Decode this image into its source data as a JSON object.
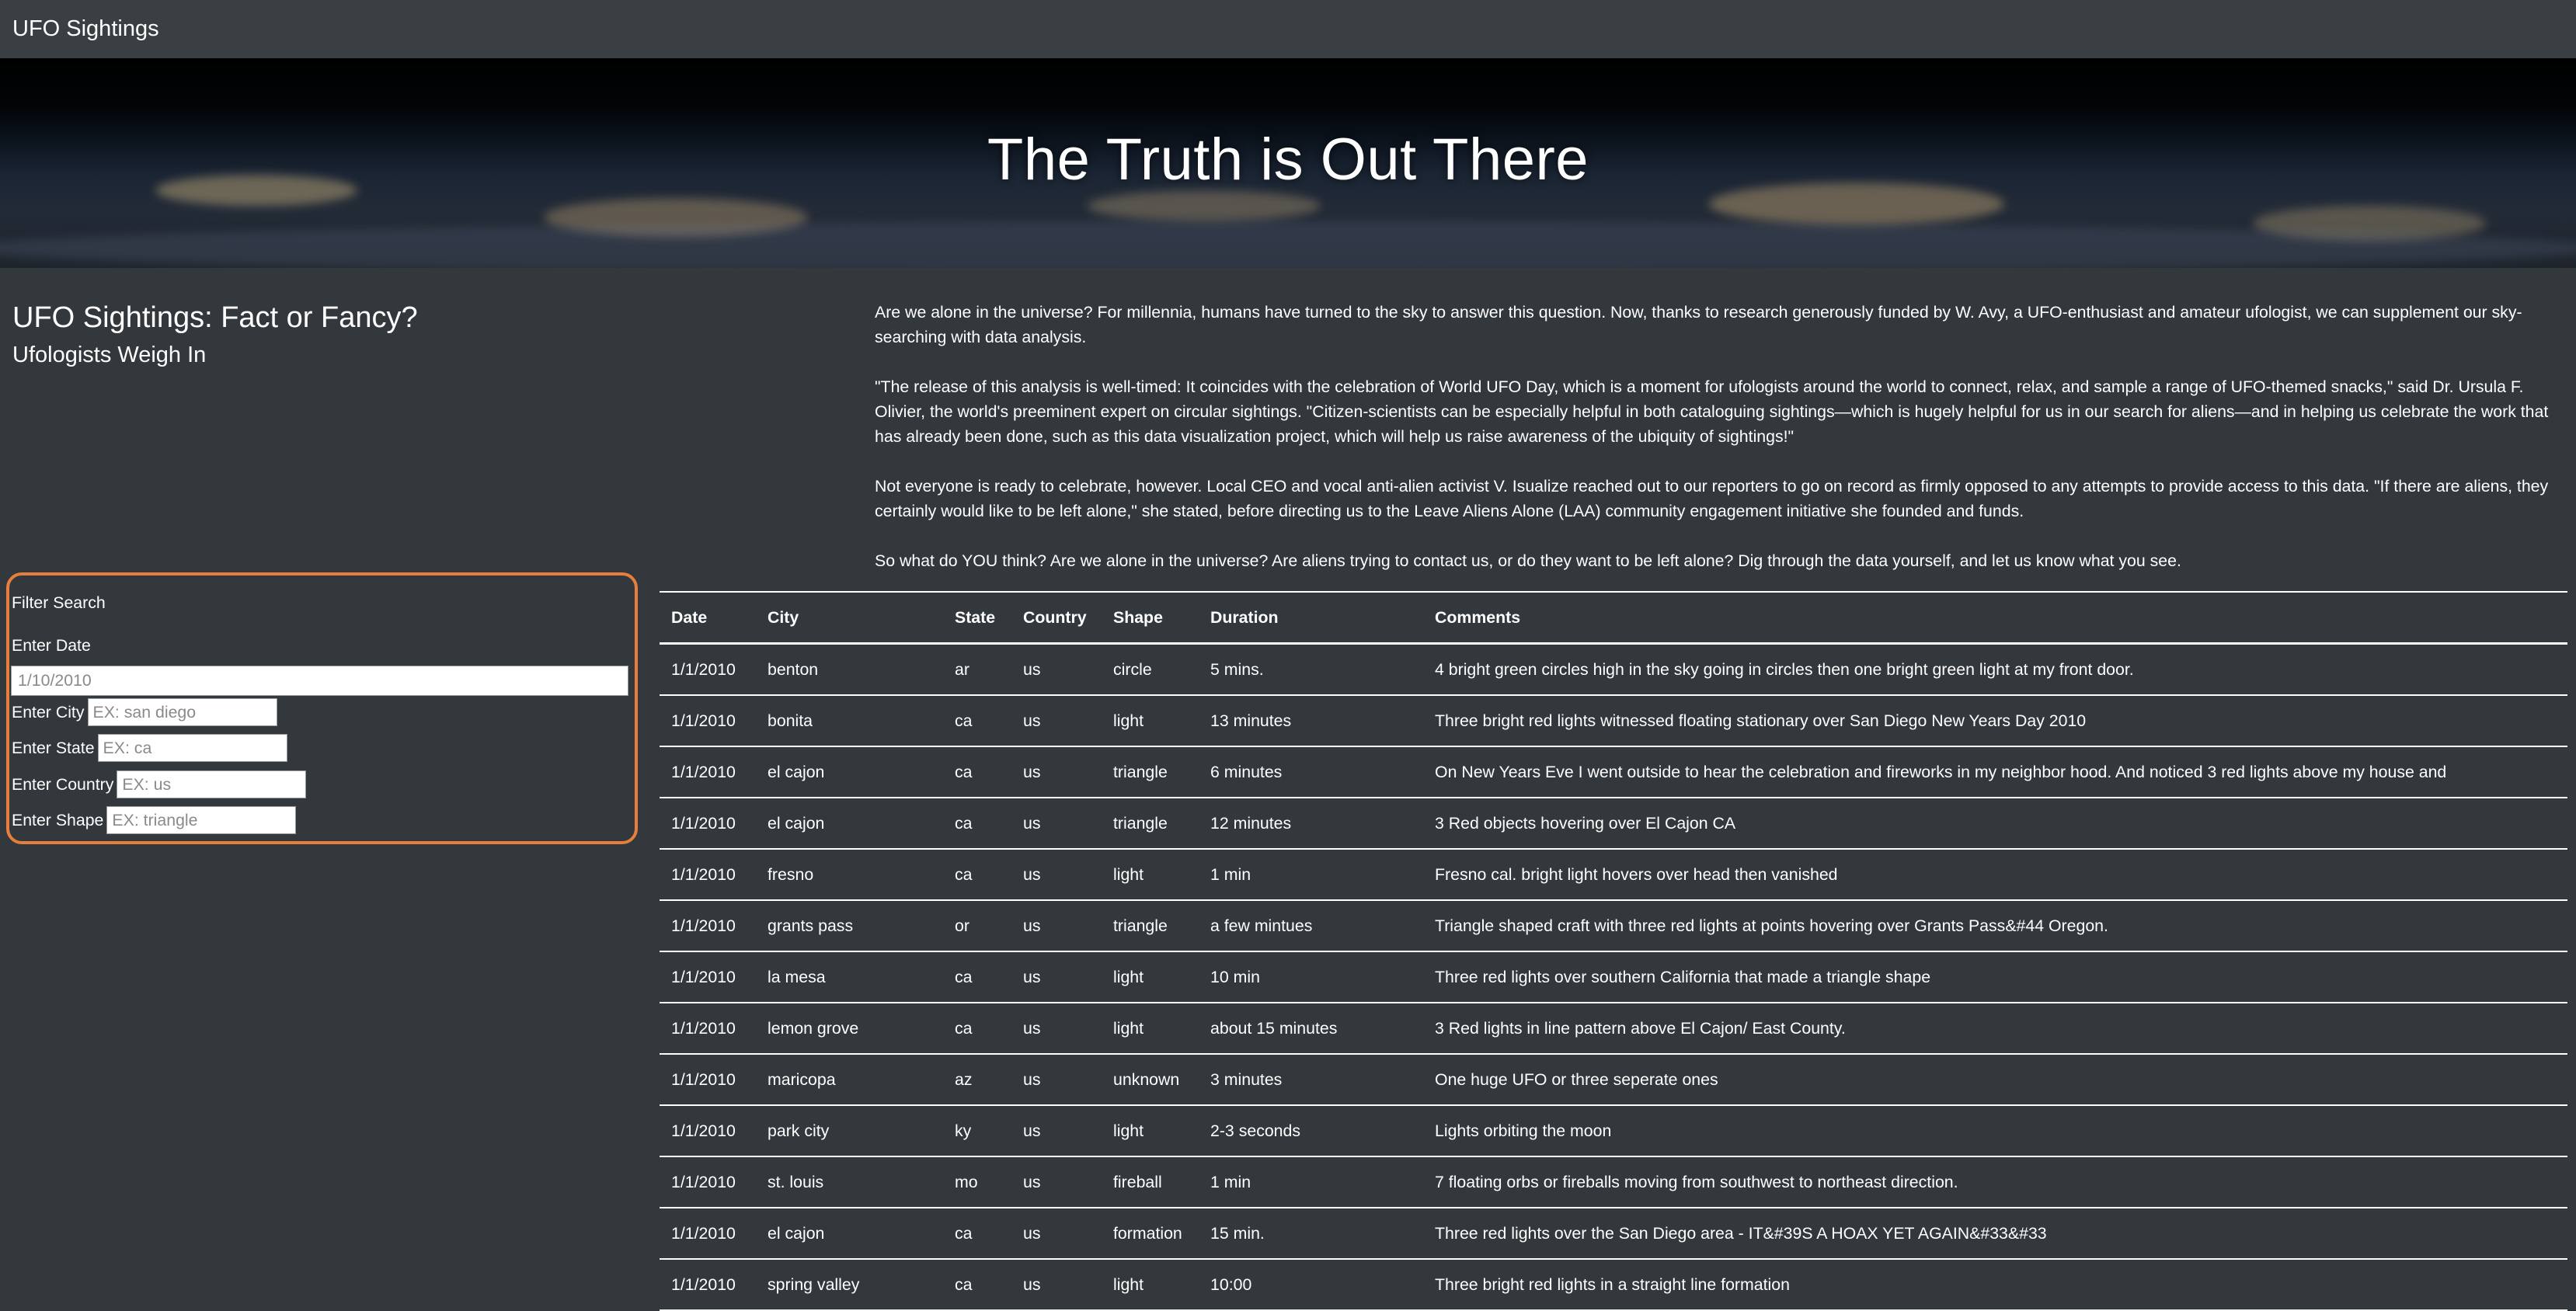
{
  "navbar": {
    "brand": "UFO Sightings"
  },
  "hero": {
    "title": "The Truth is Out There"
  },
  "intro": {
    "heading": "UFO Sightings: Fact or Fancy?",
    "subheading": "Ufologists Weigh In"
  },
  "article": {
    "paragraphs": [
      "Are we alone in the universe? For millennia, humans have turned to the sky to answer this question. Now, thanks to research generously funded by W. Avy, a UFO-enthusiast and amateur ufologist, we can supplement our sky-searching with data analysis.",
      "\"The release of this analysis is well-timed: It coincides with the celebration of World UFO Day, which is a moment for ufologists around the world to connect, relax, and sample a range of UFO-themed snacks,\" said Dr. Ursula F. Olivier, the world's preeminent expert on circular sightings. \"Citizen-scientists can be especially helpful in both cataloguing sightings—which is hugely helpful for us in our search for aliens—and in helping us celebrate the work that has already been done, such as this data visualization project, which will help us raise awareness of the ubiquity of sightings!\"",
      "Not everyone is ready to celebrate, however. Local CEO and vocal anti-alien activist V. Isualize reached out to our reporters to go on record as firmly opposed to any attempts to provide access to this data. \"If there are aliens, they certainly would like to be left alone,\" she stated, before directing us to the Leave Aliens Alone (LAA) community engagement initiative she founded and funds.",
      "So what do YOU think? Are we alone in the universe? Are aliens trying to contact us, or do they want to be left alone? Dig through the data yourself, and let us know what you see."
    ]
  },
  "filters": {
    "title": "Filter Search",
    "date_label": "Enter Date",
    "date_placeholder": "1/10/2010",
    "city_label": "Enter City",
    "city_placeholder": "EX: san diego",
    "state_label": "Enter State",
    "state_placeholder": "EX: ca",
    "country_label": "Enter Country",
    "country_placeholder": "EX: us",
    "shape_label": "Enter Shape",
    "shape_placeholder": "EX: triangle",
    "accent_color": "#e67e3c"
  },
  "table": {
    "headers": [
      "Date",
      "City",
      "State",
      "Country",
      "Shape",
      "Duration",
      "Comments"
    ],
    "rows": [
      [
        "1/1/2010",
        "benton",
        "ar",
        "us",
        "circle",
        "5 mins.",
        "4 bright green circles high in the sky going in circles then one bright green light at my front door."
      ],
      [
        "1/1/2010",
        "bonita",
        "ca",
        "us",
        "light",
        "13 minutes",
        "Three bright red lights witnessed floating stationary over San Diego New Years Day 2010"
      ],
      [
        "1/1/2010",
        "el cajon",
        "ca",
        "us",
        "triangle",
        "6 minutes",
        "On New Years Eve I went outside to hear the celebration and fireworks in my neighbor hood. And noticed 3 red lights above my house and"
      ],
      [
        "1/1/2010",
        "el cajon",
        "ca",
        "us",
        "triangle",
        "12 minutes",
        "3 Red objects hovering over El Cajon CA"
      ],
      [
        "1/1/2010",
        "fresno",
        "ca",
        "us",
        "light",
        "1 min",
        "Fresno cal. bright light hovers over head then vanished"
      ],
      [
        "1/1/2010",
        "grants pass",
        "or",
        "us",
        "triangle",
        "a few mintues",
        "Triangle shaped craft with three red lights at points hovering over Grants Pass&#44 Oregon."
      ],
      [
        "1/1/2010",
        "la mesa",
        "ca",
        "us",
        "light",
        "10 min",
        "Three red lights over southern California that made a triangle shape"
      ],
      [
        "1/1/2010",
        "lemon grove",
        "ca",
        "us",
        "light",
        "about 15 minutes",
        "3 Red lights in line pattern above El Cajon/ East County."
      ],
      [
        "1/1/2010",
        "maricopa",
        "az",
        "us",
        "unknown",
        "3 minutes",
        "One huge UFO or three seperate ones"
      ],
      [
        "1/1/2010",
        "park city",
        "ky",
        "us",
        "light",
        "2-3 seconds",
        "Lights orbiting the moon"
      ],
      [
        "1/1/2010",
        "st. louis",
        "mo",
        "us",
        "fireball",
        "1 min",
        "7 floating orbs or fireballs moving from southwest to northeast direction."
      ],
      [
        "1/1/2010",
        "el cajon",
        "ca",
        "us",
        "formation",
        "15 min.",
        "Three red lights over the San Diego area - IT&#39S A HOAX YET AGAIN&#33&#33"
      ],
      [
        "1/1/2010",
        "spring valley",
        "ca",
        "us",
        "light",
        "10:00",
        "Three bright red lights in a straight line formation"
      ]
    ]
  }
}
